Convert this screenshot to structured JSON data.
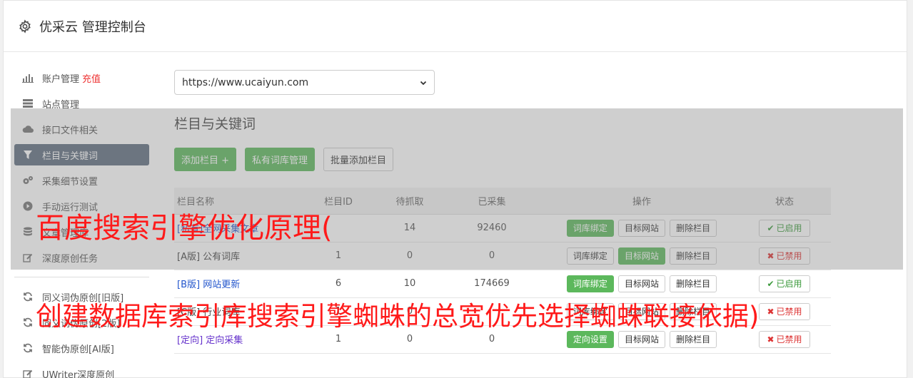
{
  "header": {
    "title": "优采云 管理控制台"
  },
  "sidebar": {
    "items": [
      {
        "label": "账户管理",
        "extra": "充值"
      },
      {
        "label": "站点管理"
      },
      {
        "label": "接口文件相关"
      },
      {
        "label": "栏目与关键词"
      },
      {
        "label": "采集细节设置"
      },
      {
        "label": "手动运行测试"
      },
      {
        "label": "文章管理库"
      },
      {
        "label": "深度原创任务"
      },
      {
        "label": "同义词伪原创[旧版]"
      },
      {
        "label": "同义词伪原创[2版]"
      },
      {
        "label": "智能伪原创[AI版]"
      },
      {
        "label": "UWriter深度原创"
      }
    ]
  },
  "main": {
    "site_select": "https://www.ucaiyun.com",
    "section_title": "栏目与关键词",
    "buttons": {
      "add": "添加栏目 +",
      "private": "私有词库管理",
      "batch": "批量添加栏目"
    },
    "table": {
      "headers": [
        "栏目名称",
        "栏目ID",
        "待抓取",
        "已采集",
        "操作",
        "状态"
      ],
      "rows": [
        {
          "name": "[私有]全网采集文章",
          "id": "",
          "wait": "14",
          "done": "92460",
          "op1": "词库绑定",
          "op2": "目标网站",
          "op3": "删除栏目",
          "status": "已启用"
        },
        {
          "name": "[A版] 公有词库",
          "id": "1",
          "wait": "0",
          "done": "0",
          "op1": "词库绑定",
          "op2": "目标网站",
          "op3": "删除栏目",
          "status": "已禁用"
        },
        {
          "name": "[B版] 网站更新",
          "id": "6",
          "wait": "10",
          "done": "174669",
          "op1": "词库绑定",
          "op2": "目标网站",
          "op3": "删除栏目",
          "status": "已启用"
        },
        {
          "name": "[C版] 行业词库",
          "id": "1",
          "wait": "0",
          "done": "",
          "op1": "词库绑定",
          "op2": "目标网站",
          "op3": "删除栏目",
          "status": "已禁用"
        },
        {
          "name": "[定向] 定向采集",
          "id": "1",
          "wait": "0",
          "done": "0",
          "op1": "定向设置",
          "op2": "目标网站",
          "op3": "删除栏目",
          "status": "已禁用"
        }
      ]
    }
  },
  "overlay_text": {
    "line1": "百度搜索引擎优化原理(",
    "line2": "创建数据库索引库搜索引擎蜘蛛的总宽优先选择蜘蛛联接依据)"
  }
}
